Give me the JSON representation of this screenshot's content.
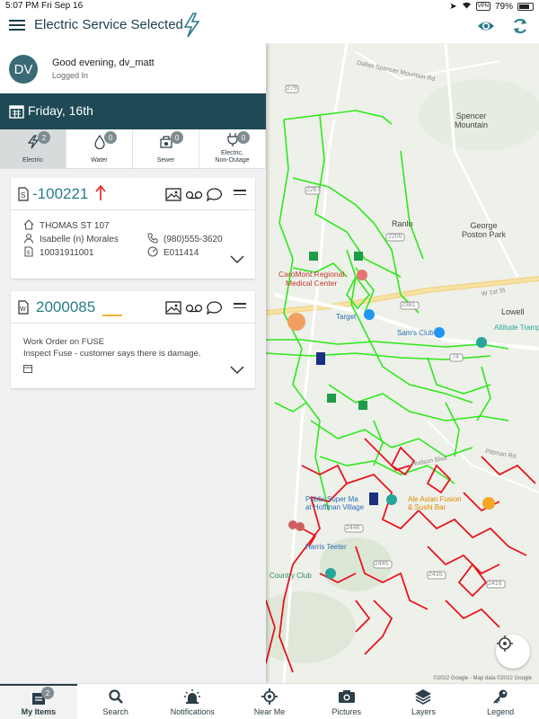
{
  "status_bar": {
    "time": "5:07 PM",
    "date": "Fri Sep 16",
    "vpn": "VPN",
    "battery": "79%",
    "battery_level": 0.79
  },
  "app_bar": {
    "title": "Electric Service Selected"
  },
  "user": {
    "initials": "DV",
    "greeting": "Good evening, dv_matt",
    "status": "Logged In"
  },
  "date_band": {
    "label": "Friday, 16th"
  },
  "tabs": [
    {
      "label": "Electric",
      "count": "2",
      "icon": "bolt-icon"
    },
    {
      "label": "Water",
      "count": "0",
      "icon": "water-drop-icon"
    },
    {
      "label": "Sewer",
      "count": "0",
      "icon": "sewer-icon"
    },
    {
      "label": "Electric,\nNon-Outage",
      "count": "0",
      "icon": "plug-icon"
    }
  ],
  "cards": [
    {
      "number": "-100221",
      "priority": "high",
      "priority_color": "#e53935",
      "address": "THOMAS ST 107",
      "contact": "Isabelle (n) Morales",
      "phone": "(980)555-3620",
      "account": "10031911001",
      "meter": "E011414"
    },
    {
      "number": "2000085",
      "priority": "medium",
      "priority_color": "#f5a623",
      "title": "Work Order on FUSE",
      "description": "Inspect Fuse - customer says there is damage."
    }
  ],
  "map": {
    "labels": {
      "spencer_mountain": "Spencer\nMountain",
      "ranlo": "Ranlo",
      "george_poston_park": "George\nPoston Park",
      "lowell": "Lowell",
      "hospital": "CaroMont Regional\nMedical Center",
      "target": "Target",
      "sams_club": "Sam's Club",
      "altitude": "Altitude Trampol",
      "publix": "Publix Super Ma\nat Hoffman Village",
      "asian_fusion": "Ale Asian Fusion\n& Sushi Bar",
      "harris_teeter": "Harris Teeter",
      "country_club": "Country Club",
      "dallas_spencer": "Dallas Spencer Mountain Rd",
      "w_1st": "W 1st St",
      "hudson": "Hudson Blvd",
      "pittman": "Pittman Rd",
      "rd_2200": "2200",
      "rd_2267": "2267",
      "rd_279": "279",
      "rd_2381": "2381",
      "rd_74": "74",
      "rd_2446": "2446",
      "rd_2445": "2445",
      "rd_2435": "2435",
      "rd_2416": "2416",
      "copyright": "©2022 Google - Map data ©2022 Google"
    }
  },
  "bottom_nav": [
    {
      "label": "My Items",
      "count": "2",
      "icon": "inbox-icon"
    },
    {
      "label": "Search",
      "icon": "search-icon"
    },
    {
      "label": "Notifications",
      "icon": "alarm-icon"
    },
    {
      "label": "Near Me",
      "icon": "crosshair-icon"
    },
    {
      "label": "Pictures",
      "icon": "camera-icon"
    },
    {
      "label": "Layers",
      "icon": "layers-icon"
    },
    {
      "label": "Legend",
      "icon": "key-icon"
    }
  ]
}
